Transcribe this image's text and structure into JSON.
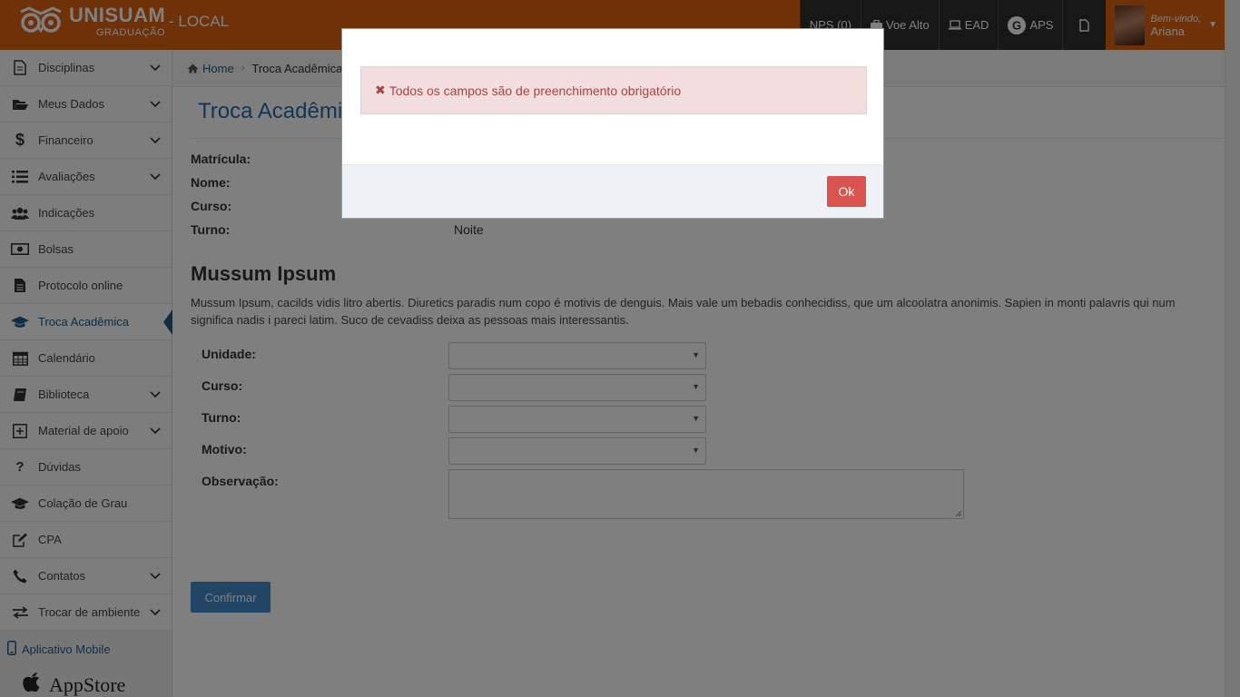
{
  "header": {
    "brand_name": "UNISUAM",
    "brand_sub": "GRADUAÇÃO",
    "environment": "- LOCAL",
    "nav": [
      {
        "label": "NPS (0)",
        "icon": "none"
      },
      {
        "label": "Voe Alto",
        "icon": "briefcase-icon"
      },
      {
        "label": "EAD",
        "icon": "laptop-icon"
      },
      {
        "label": "APS",
        "icon": "google-icon"
      },
      {
        "label": "",
        "icon": "document-icon"
      }
    ],
    "user": {
      "greeting": "Bem-vindo,",
      "name": "Ariana"
    },
    "colors": {
      "bar": "#de6410",
      "nav_bg": "#2f2f2f"
    }
  },
  "sidebar": {
    "items": [
      {
        "label": "Disciplinas",
        "icon": "document-icon",
        "expandable": true
      },
      {
        "label": "Meus Dados",
        "icon": "folder-open-icon",
        "expandable": true
      },
      {
        "label": "Financeiro",
        "icon": "dollar-icon",
        "expandable": true
      },
      {
        "label": "Avaliações",
        "icon": "list-icon",
        "expandable": true
      },
      {
        "label": "Indicações",
        "icon": "users-icon",
        "expandable": false
      },
      {
        "label": "Bolsas",
        "icon": "money-icon",
        "expandable": false
      },
      {
        "label": "Protocolo online",
        "icon": "file-text-icon",
        "expandable": false
      },
      {
        "label": "Troca Acadêmica",
        "icon": "graduation-cap-icon",
        "expandable": false,
        "active": true
      },
      {
        "label": "Calendário",
        "icon": "calendar-icon",
        "expandable": false
      },
      {
        "label": "Biblioteca",
        "icon": "book-icon",
        "expandable": true
      },
      {
        "label": "Material de apoio",
        "icon": "plus-square-icon",
        "expandable": true
      },
      {
        "label": "Dúvidas",
        "icon": "question-icon",
        "expandable": false
      },
      {
        "label": "Colação de Grau",
        "icon": "graduation-cap-icon",
        "expandable": false
      },
      {
        "label": "CPA",
        "icon": "edit-icon",
        "expandable": false
      },
      {
        "label": "Contatos",
        "icon": "phone-icon",
        "expandable": true
      },
      {
        "label": "Trocar de ambiente",
        "icon": "exchange-icon",
        "expandable": true
      }
    ],
    "mobile_label": "Aplicativo Mobile",
    "appstore_label": "AppStore",
    "accent": "#1d5b8c"
  },
  "breadcrumb": {
    "home": "Home",
    "current": "Troca Acadêmica"
  },
  "page": {
    "title": "Troca Acadêmica",
    "info": [
      {
        "label": "Matrícula:",
        "value": ""
      },
      {
        "label": "Nome:",
        "value": ""
      },
      {
        "label": "Curso:",
        "value": ""
      },
      {
        "label": "Turno:",
        "value": "Noite"
      }
    ],
    "section_title": "Mussum Ipsum",
    "section_text": "Mussum Ipsum, cacilds vidis litro abertis. Diuretics paradis num copo é motivis de denguis. Mais vale um bebadis conhecidiss, que um alcoolatra anonimis. Sapien in monti palavris qui num significa nadis i pareci latim. Suco de cevadiss deixa as pessoas mais interessantis.",
    "form": {
      "unidade_label": "Unidade:",
      "curso_label": "Curso:",
      "turno_label": "Turno:",
      "motivo_label": "Motivo:",
      "observacao_label": "Observação:",
      "unidade_value": "",
      "curso_value": "",
      "turno_value": "",
      "motivo_value": ""
    },
    "confirm_label": "Confirmar"
  },
  "modal": {
    "message": "Todos os campos são de preenchimento obrigatório",
    "ok_label": "Ok",
    "alert_color": "#a94442",
    "button_color": "#d9534f"
  }
}
